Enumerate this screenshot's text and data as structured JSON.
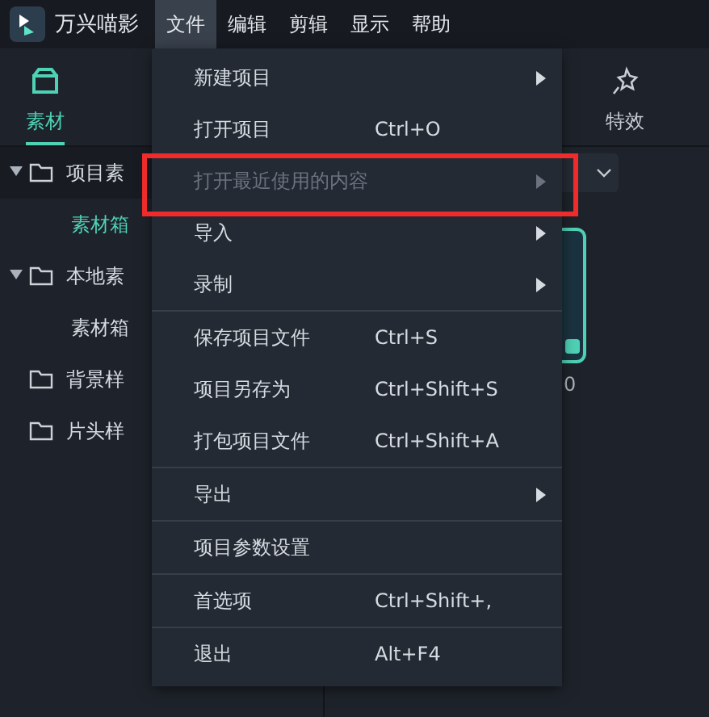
{
  "app": {
    "name": "万兴喵影"
  },
  "menubar": [
    {
      "label": "文件",
      "selected": true
    },
    {
      "label": "编辑",
      "selected": false
    },
    {
      "label": "剪辑",
      "selected": false
    },
    {
      "label": "显示",
      "selected": false
    },
    {
      "label": "帮助",
      "selected": false
    }
  ],
  "left_tabs": [
    {
      "label": "素材",
      "selected": true
    }
  ],
  "tree": [
    {
      "label": "项目素",
      "expanded": true,
      "selected": false,
      "children": [
        {
          "label": "素材箱",
          "selected": true
        }
      ]
    },
    {
      "label": "本地素",
      "expanded": true,
      "selected": false,
      "children": [
        {
          "label": "素材箱",
          "selected": false
        }
      ]
    },
    {
      "label": "背景样",
      "expanded": false,
      "selected": false
    },
    {
      "label": "片头样",
      "expanded": false,
      "selected": false
    }
  ],
  "right_tabs": [
    {
      "label": "特效",
      "selected": false
    }
  ],
  "media_card": {
    "caption": "0",
    "checked": true
  },
  "file_menu": [
    {
      "label": "新建项目",
      "submenu": true,
      "disabled": false,
      "separator_before": false,
      "highlighted": false
    },
    {
      "label": "打开项目",
      "shortcut": "Ctrl+O",
      "submenu": false,
      "disabled": false,
      "separator_before": false,
      "highlighted": false
    },
    {
      "label": "打开最近使用的内容",
      "submenu": true,
      "disabled": true,
      "separator_before": false,
      "highlighted": true
    },
    {
      "label": "导入",
      "submenu": true,
      "disabled": false,
      "separator_before": false,
      "highlighted": false
    },
    {
      "label": "录制",
      "submenu": true,
      "disabled": false,
      "separator_before": false,
      "highlighted": false
    },
    {
      "label": "保存项目文件",
      "shortcut": "Ctrl+S",
      "submenu": false,
      "disabled": false,
      "separator_before": true,
      "highlighted": false
    },
    {
      "label": "项目另存为",
      "shortcut": "Ctrl+Shift+S",
      "submenu": false,
      "disabled": false,
      "separator_before": false,
      "highlighted": false
    },
    {
      "label": "打包项目文件",
      "shortcut": "Ctrl+Shift+A",
      "submenu": false,
      "disabled": false,
      "separator_before": false,
      "highlighted": false
    },
    {
      "label": "导出",
      "submenu": true,
      "disabled": false,
      "separator_before": true,
      "highlighted": false
    },
    {
      "label": "项目参数设置",
      "submenu": false,
      "disabled": false,
      "separator_before": true,
      "highlighted": false
    },
    {
      "label": "首选项",
      "shortcut": "Ctrl+Shift+,",
      "submenu": false,
      "disabled": false,
      "separator_before": true,
      "highlighted": false
    },
    {
      "label": "退出",
      "shortcut": "Alt+F4",
      "submenu": false,
      "disabled": false,
      "separator_before": true,
      "highlighted": false
    }
  ]
}
